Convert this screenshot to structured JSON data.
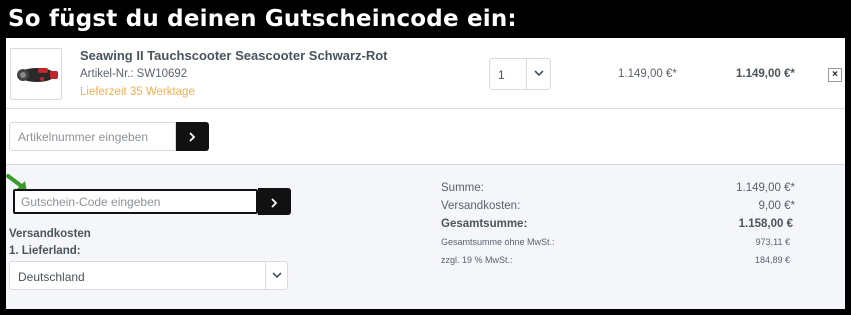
{
  "banner": {
    "title": "So fügst du deinen Gutscheincode ein:"
  },
  "cart_item": {
    "name": "Seawing II Tauchscooter Seascooter Schwarz-Rot",
    "sku_label": "Artikel-Nr.:",
    "sku": "SW10692",
    "delivery": "Lieferzeit 35 Werktage",
    "quantity": "1",
    "unit_price": "1.149,00 €*",
    "total_price": "1.149,00 €*",
    "remove_label": "×"
  },
  "article_search": {
    "placeholder": "Artikelnummer eingeben"
  },
  "voucher": {
    "placeholder": "Gutschein-Code eingeben"
  },
  "shipping": {
    "title": "Versandkosten",
    "country_label": "1. Lieferland:",
    "country": "Deutschland"
  },
  "summary": {
    "subtotal_label": "Summe:",
    "subtotal_value": "1.149,00 €*",
    "shipping_label": "Versandkosten:",
    "shipping_value": "9,00 €*",
    "total_label": "Gesamtsumme:",
    "total_value": "1.158,00 €",
    "net_label": "Gesamtsumme ohne MwSt.:",
    "net_value": "973,11 €",
    "tax_label": "zzgl. 19 % MwSt.:",
    "tax_value": "184,89 €"
  },
  "icons": {
    "arrow": "arrow-right-icon",
    "chevron": "chevron-down-icon",
    "pointer": "green-arrow-icon"
  },
  "colors": {
    "delivery": "#f0b050",
    "button": "#111111",
    "pointer": "#3a9a2a"
  }
}
